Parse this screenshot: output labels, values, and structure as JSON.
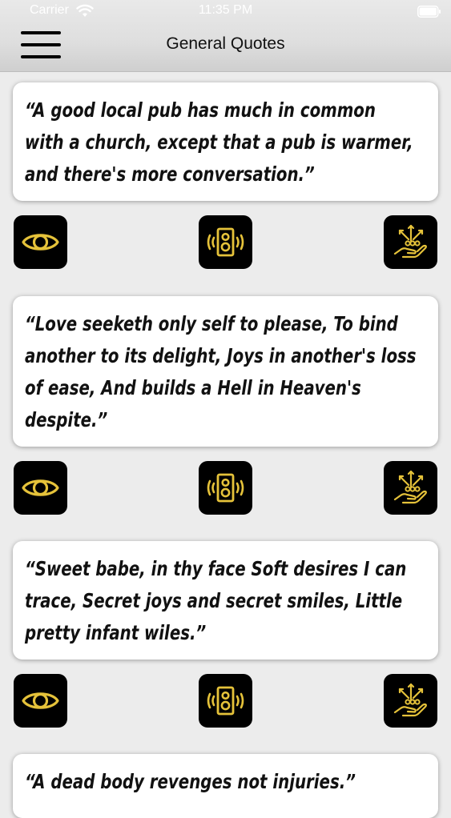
{
  "status_bar": {
    "carrier": "Carrier",
    "time": "11:35 PM"
  },
  "header": {
    "title": "General Quotes",
    "menu_icon": "hamburger-menu-icon"
  },
  "colors": {
    "accent": "#e5c23a",
    "button_bg": "#000000",
    "card_bg": "#ffffff"
  },
  "quotes": [
    {
      "text": "“A good local pub has much in common\nwith a church, except that a pub is warmer,\nand there's more conversation.”"
    },
    {
      "text": "“Love seeketh only self to please, To bind\nanother to its delight, Joys in another's loss\nof ease, And builds a Hell in Heaven's\ndespite.”"
    },
    {
      "text": "“Sweet babe, in thy face Soft desires I can\ntrace, Secret joys and secret smiles, Little\npretty infant wiles.”"
    },
    {
      "text": "“A dead body revenges not injuries.”"
    }
  ],
  "actions": {
    "view_icon": "eye-icon",
    "speak_icon": "speaker-icon",
    "share_icon": "share-hand-icon"
  }
}
